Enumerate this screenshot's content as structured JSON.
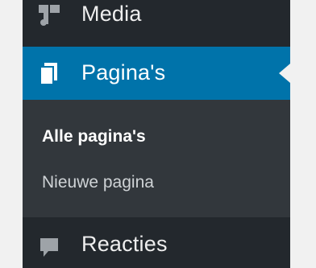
{
  "sidebar": {
    "items": [
      {
        "label": "Media",
        "icon": "media-icon"
      },
      {
        "label": "Pagina's",
        "icon": "pages-icon",
        "active": true
      },
      {
        "label": "Reacties",
        "icon": "comments-icon"
      }
    ],
    "submenu": {
      "current": "Alle pagina's",
      "other": "Nieuwe pagina"
    }
  },
  "colors": {
    "sidebar_bg": "#23282d",
    "submenu_bg": "#32373c",
    "active_bg": "#0073aa",
    "page_bg": "#f1f1f1"
  }
}
